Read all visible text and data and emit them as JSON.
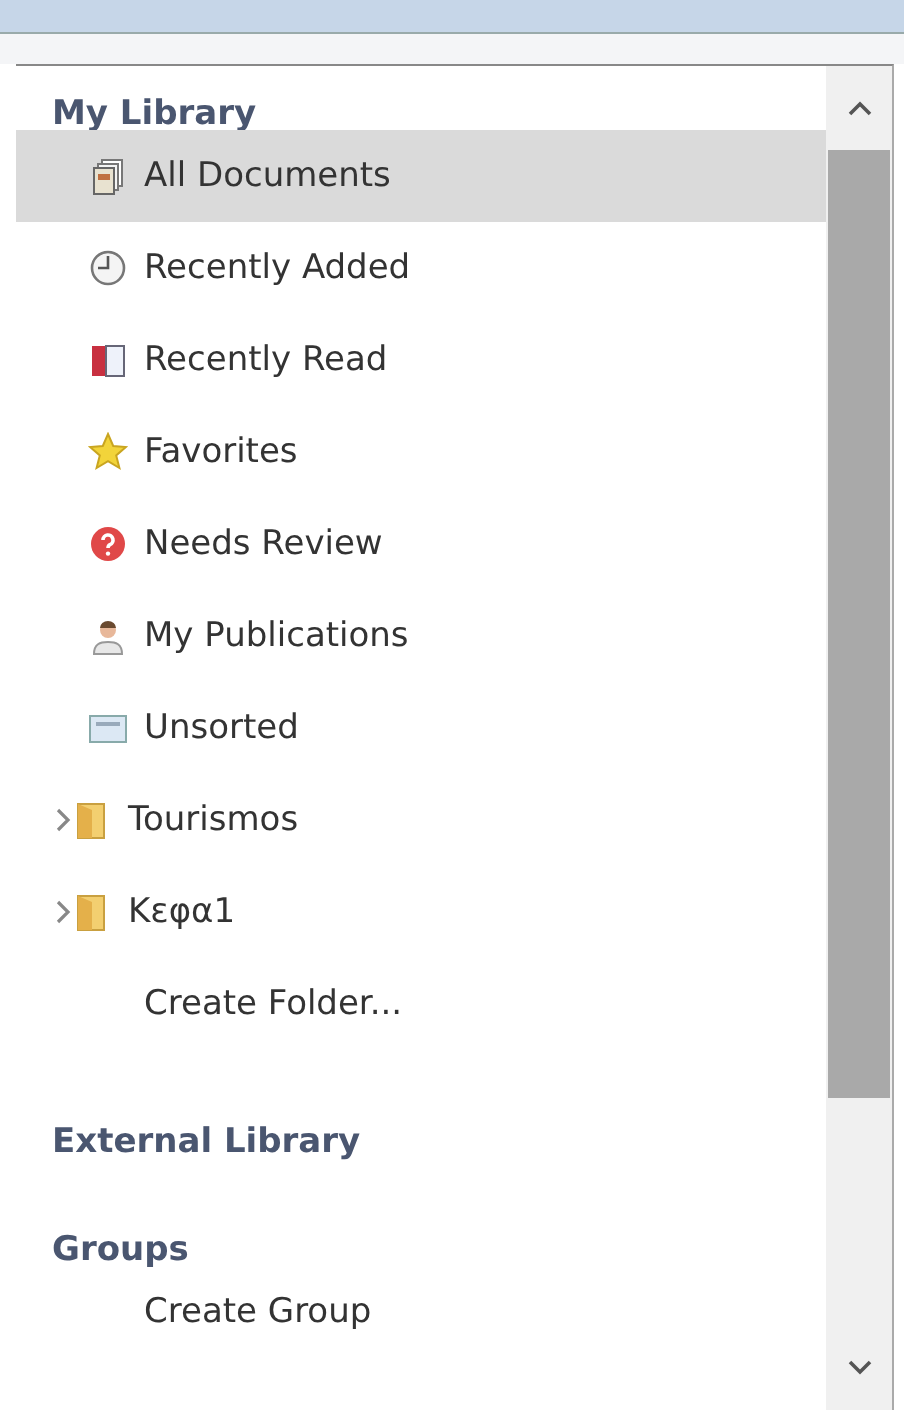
{
  "sections": [
    {
      "title": "My Library",
      "items": [
        {
          "kind": "item",
          "label": "All Documents",
          "selected": true
        },
        {
          "kind": "item",
          "label": "Recently Added",
          "selected": false
        },
        {
          "kind": "item",
          "label": "Recently Read",
          "selected": false
        },
        {
          "kind": "item",
          "label": "Favorites",
          "selected": false
        },
        {
          "kind": "item",
          "label": "Needs Review",
          "selected": false
        },
        {
          "kind": "item",
          "label": "My Publications",
          "selected": false
        },
        {
          "kind": "item",
          "label": "Unsorted",
          "selected": false
        },
        {
          "kind": "folder",
          "label": "Tourismos",
          "selected": false,
          "expanded": false
        },
        {
          "kind": "folder",
          "label": "Κεφα1",
          "selected": false,
          "expanded": false
        },
        {
          "kind": "action",
          "label": "Create Folder...",
          "selected": false
        }
      ]
    },
    {
      "title": "External Library"
    },
    {
      "title": "Groups",
      "items": [
        {
          "kind": "action",
          "label": "Create Group",
          "selected": false
        }
      ]
    }
  ]
}
